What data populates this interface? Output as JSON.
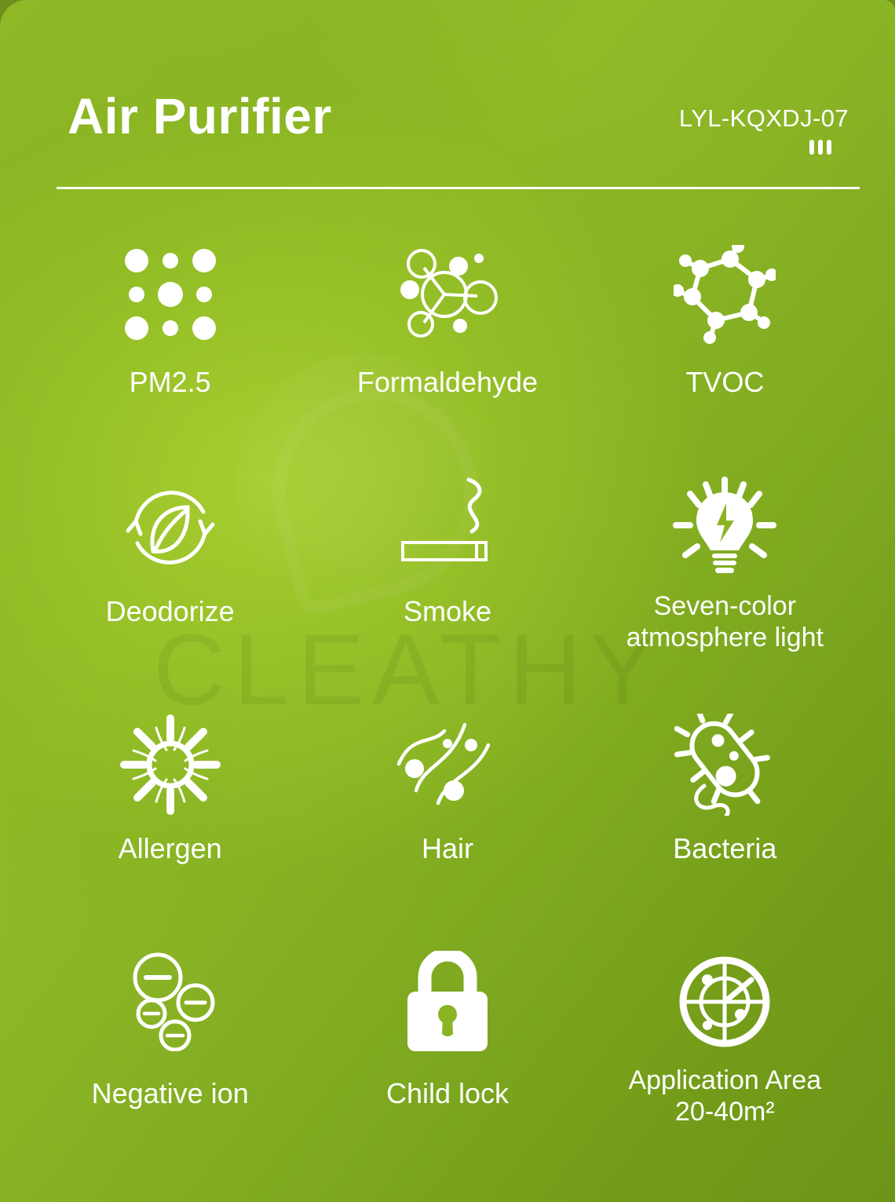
{
  "product": {
    "title": "Air Purifier",
    "model": "LYL-KQXDJ-07",
    "watermark": "CLEATHY"
  },
  "colors": {
    "background_light": "#93bb27",
    "background_dark": "#6d9417",
    "foreground": "#ffffff"
  },
  "features": [
    {
      "label": "PM2.5",
      "icon": "dot-grid-icon"
    },
    {
      "label": "Formaldehyde",
      "icon": "molecule-icon"
    },
    {
      "label": "TVOC",
      "icon": "benzene-ring-icon"
    },
    {
      "label": "Deodorize",
      "icon": "leaf-recycle-icon"
    },
    {
      "label": "Smoke",
      "icon": "cigarette-smoke-icon"
    },
    {
      "label": "Seven-color\natmosphere light",
      "icon": "light-bulb-icon"
    },
    {
      "label": "Allergen",
      "icon": "pollen-burst-icon"
    },
    {
      "label": "Hair",
      "icon": "hair-strands-icon"
    },
    {
      "label": "Bacteria",
      "icon": "bacteria-icon"
    },
    {
      "label": "Negative ion",
      "icon": "negative-ion-icon"
    },
    {
      "label": "Child lock",
      "icon": "padlock-icon"
    },
    {
      "label": "Application Area\n20-40m²",
      "icon": "radar-target-icon"
    }
  ]
}
